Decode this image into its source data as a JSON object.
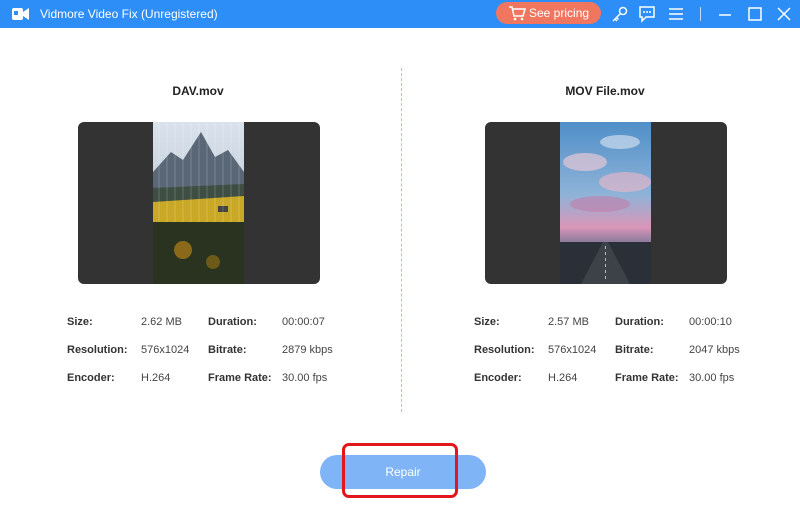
{
  "window": {
    "title": "Vidmore Video Fix (Unregistered)"
  },
  "toolbar": {
    "pricing_label": "See pricing",
    "icons": [
      "cart-icon",
      "key-icon",
      "feedback-icon",
      "menu-icon",
      "minimize-icon",
      "maximize-icon",
      "close-icon"
    ]
  },
  "left": {
    "filename": "DAV.mov",
    "size_label": "Size:",
    "size": "2.62 MB",
    "duration_label": "Duration:",
    "duration": "00:00:07",
    "resolution_label": "Resolution:",
    "resolution": "576x1024",
    "bitrate_label": "Bitrate:",
    "bitrate": "2879 kbps",
    "encoder_label": "Encoder:",
    "encoder": "H.264",
    "framerate_label": "Frame Rate:",
    "framerate": "30.00 fps"
  },
  "right": {
    "filename": "MOV File.mov",
    "size_label": "Size:",
    "size": "2.57 MB",
    "duration_label": "Duration:",
    "duration": "00:00:10",
    "resolution_label": "Resolution:",
    "resolution": "576x1024",
    "bitrate_label": "Bitrate:",
    "bitrate": "2047 kbps",
    "encoder_label": "Encoder:",
    "encoder": "H.264",
    "framerate_label": "Frame Rate:",
    "framerate": "30.00 fps"
  },
  "actions": {
    "repair_label": "Repair"
  },
  "colors": {
    "titlebar": "#2d8ef7",
    "pricing": "#f0765f",
    "repair": "#7fb4f6",
    "highlight": "#e2161c"
  }
}
